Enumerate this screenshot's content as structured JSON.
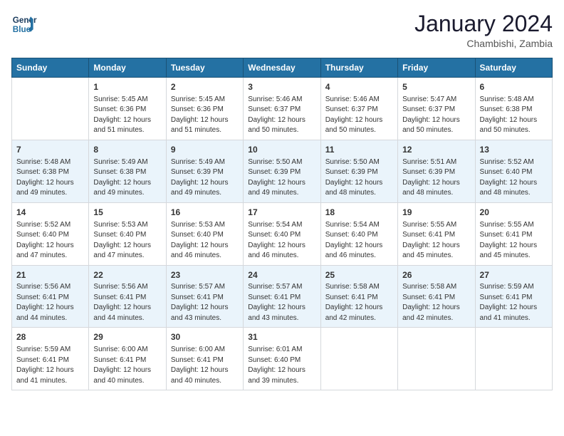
{
  "header": {
    "logo_line1": "General",
    "logo_line2": "Blue",
    "month_title": "January 2024",
    "location": "Chambishi, Zambia"
  },
  "weekdays": [
    "Sunday",
    "Monday",
    "Tuesday",
    "Wednesday",
    "Thursday",
    "Friday",
    "Saturday"
  ],
  "weeks": [
    [
      {
        "day": null,
        "info": null
      },
      {
        "day": "1",
        "info": "Sunrise: 5:45 AM\nSunset: 6:36 PM\nDaylight: 12 hours\nand 51 minutes."
      },
      {
        "day": "2",
        "info": "Sunrise: 5:45 AM\nSunset: 6:36 PM\nDaylight: 12 hours\nand 51 minutes."
      },
      {
        "day": "3",
        "info": "Sunrise: 5:46 AM\nSunset: 6:37 PM\nDaylight: 12 hours\nand 50 minutes."
      },
      {
        "day": "4",
        "info": "Sunrise: 5:46 AM\nSunset: 6:37 PM\nDaylight: 12 hours\nand 50 minutes."
      },
      {
        "day": "5",
        "info": "Sunrise: 5:47 AM\nSunset: 6:37 PM\nDaylight: 12 hours\nand 50 minutes."
      },
      {
        "day": "6",
        "info": "Sunrise: 5:48 AM\nSunset: 6:38 PM\nDaylight: 12 hours\nand 50 minutes."
      }
    ],
    [
      {
        "day": "7",
        "info": "Sunrise: 5:48 AM\nSunset: 6:38 PM\nDaylight: 12 hours\nand 49 minutes."
      },
      {
        "day": "8",
        "info": "Sunrise: 5:49 AM\nSunset: 6:38 PM\nDaylight: 12 hours\nand 49 minutes."
      },
      {
        "day": "9",
        "info": "Sunrise: 5:49 AM\nSunset: 6:39 PM\nDaylight: 12 hours\nand 49 minutes."
      },
      {
        "day": "10",
        "info": "Sunrise: 5:50 AM\nSunset: 6:39 PM\nDaylight: 12 hours\nand 49 minutes."
      },
      {
        "day": "11",
        "info": "Sunrise: 5:50 AM\nSunset: 6:39 PM\nDaylight: 12 hours\nand 48 minutes."
      },
      {
        "day": "12",
        "info": "Sunrise: 5:51 AM\nSunset: 6:39 PM\nDaylight: 12 hours\nand 48 minutes."
      },
      {
        "day": "13",
        "info": "Sunrise: 5:52 AM\nSunset: 6:40 PM\nDaylight: 12 hours\nand 48 minutes."
      }
    ],
    [
      {
        "day": "14",
        "info": "Sunrise: 5:52 AM\nSunset: 6:40 PM\nDaylight: 12 hours\nand 47 minutes."
      },
      {
        "day": "15",
        "info": "Sunrise: 5:53 AM\nSunset: 6:40 PM\nDaylight: 12 hours\nand 47 minutes."
      },
      {
        "day": "16",
        "info": "Sunrise: 5:53 AM\nSunset: 6:40 PM\nDaylight: 12 hours\nand 46 minutes."
      },
      {
        "day": "17",
        "info": "Sunrise: 5:54 AM\nSunset: 6:40 PM\nDaylight: 12 hours\nand 46 minutes."
      },
      {
        "day": "18",
        "info": "Sunrise: 5:54 AM\nSunset: 6:40 PM\nDaylight: 12 hours\nand 46 minutes."
      },
      {
        "day": "19",
        "info": "Sunrise: 5:55 AM\nSunset: 6:41 PM\nDaylight: 12 hours\nand 45 minutes."
      },
      {
        "day": "20",
        "info": "Sunrise: 5:55 AM\nSunset: 6:41 PM\nDaylight: 12 hours\nand 45 minutes."
      }
    ],
    [
      {
        "day": "21",
        "info": "Sunrise: 5:56 AM\nSunset: 6:41 PM\nDaylight: 12 hours\nand 44 minutes."
      },
      {
        "day": "22",
        "info": "Sunrise: 5:56 AM\nSunset: 6:41 PM\nDaylight: 12 hours\nand 44 minutes."
      },
      {
        "day": "23",
        "info": "Sunrise: 5:57 AM\nSunset: 6:41 PM\nDaylight: 12 hours\nand 43 minutes."
      },
      {
        "day": "24",
        "info": "Sunrise: 5:57 AM\nSunset: 6:41 PM\nDaylight: 12 hours\nand 43 minutes."
      },
      {
        "day": "25",
        "info": "Sunrise: 5:58 AM\nSunset: 6:41 PM\nDaylight: 12 hours\nand 42 minutes."
      },
      {
        "day": "26",
        "info": "Sunrise: 5:58 AM\nSunset: 6:41 PM\nDaylight: 12 hours\nand 42 minutes."
      },
      {
        "day": "27",
        "info": "Sunrise: 5:59 AM\nSunset: 6:41 PM\nDaylight: 12 hours\nand 41 minutes."
      }
    ],
    [
      {
        "day": "28",
        "info": "Sunrise: 5:59 AM\nSunset: 6:41 PM\nDaylight: 12 hours\nand 41 minutes."
      },
      {
        "day": "29",
        "info": "Sunrise: 6:00 AM\nSunset: 6:41 PM\nDaylight: 12 hours\nand 40 minutes."
      },
      {
        "day": "30",
        "info": "Sunrise: 6:00 AM\nSunset: 6:41 PM\nDaylight: 12 hours\nand 40 minutes."
      },
      {
        "day": "31",
        "info": "Sunrise: 6:01 AM\nSunset: 6:40 PM\nDaylight: 12 hours\nand 39 minutes."
      },
      {
        "day": null,
        "info": null
      },
      {
        "day": null,
        "info": null
      },
      {
        "day": null,
        "info": null
      }
    ]
  ]
}
